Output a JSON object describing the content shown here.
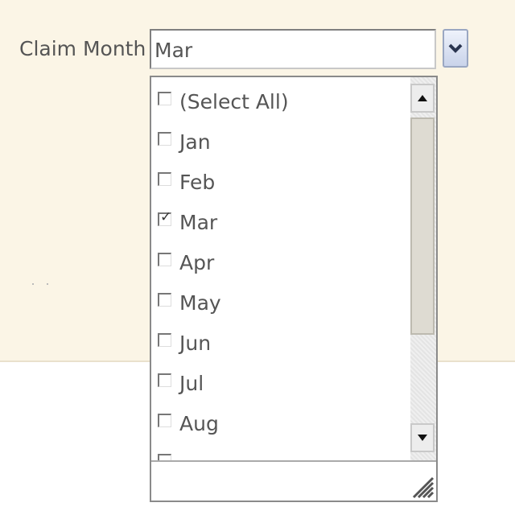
{
  "filter": {
    "label": "Claim Month",
    "value": "Mar",
    "dropdown_icon": "chevron-down-icon"
  },
  "options": [
    {
      "label": "(Select All)",
      "checked": false
    },
    {
      "label": "Jan",
      "checked": false
    },
    {
      "label": "Feb",
      "checked": false
    },
    {
      "label": "Mar",
      "checked": true
    },
    {
      "label": "Apr",
      "checked": false
    },
    {
      "label": "May",
      "checked": false
    },
    {
      "label": "Jun",
      "checked": false
    },
    {
      "label": "Jul",
      "checked": false
    },
    {
      "label": "Aug",
      "checked": false
    }
  ],
  "scrollbar": {
    "up_icon": "triangle-up-icon",
    "down_icon": "triangle-down-icon"
  },
  "check_glyph": "✓"
}
